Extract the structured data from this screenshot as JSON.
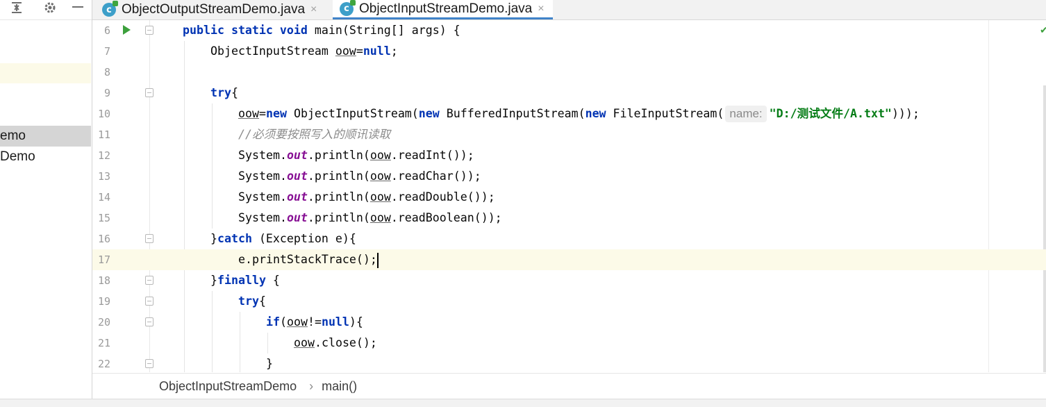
{
  "tabs": [
    {
      "label": "ObjectOutputStreamDemo.java",
      "icon": "java-class-icon",
      "close": "×",
      "active": false
    },
    {
      "label": "ObjectInputStreamDemo.java",
      "icon": "java-class-icon",
      "close": "×",
      "active": true
    }
  ],
  "project_tree": {
    "items": [
      {
        "label": "emo",
        "selected": true
      },
      {
        "label": "Demo",
        "selected": false
      }
    ]
  },
  "editor": {
    "current_line": 17,
    "lines": [
      {
        "no": "6"
      },
      {
        "no": "7"
      },
      {
        "no": "8"
      },
      {
        "no": "9"
      },
      {
        "no": "10"
      },
      {
        "no": "11"
      },
      {
        "no": "12"
      },
      {
        "no": "13"
      },
      {
        "no": "14"
      },
      {
        "no": "15"
      },
      {
        "no": "16"
      },
      {
        "no": "17"
      },
      {
        "no": "18"
      },
      {
        "no": "19"
      },
      {
        "no": "20"
      },
      {
        "no": "21"
      },
      {
        "no": "22"
      }
    ],
    "tokens": {
      "l6_public": "public",
      "l6_static": "static",
      "l6_void": "void",
      "l6_rest": " main(String[] args) {",
      "l7_type": "ObjectInputStream ",
      "l7_var": "oow",
      "l7_eq": "=",
      "l7_null": "null",
      "l7_end": ";",
      "l9_try": "try",
      "l9_brace": "{",
      "l10_var": "oow",
      "l10_eq": "=",
      "l10_new1": "new",
      "l10_a": " ObjectInputStream(",
      "l10_new2": "new",
      "l10_b": " BufferedInputStream(",
      "l10_new3": "new",
      "l10_c": " FileInputStream(",
      "l10_hint": "name:",
      "l10_str": "\"D:/测试文件/A.txt\"",
      "l10_end": ")));",
      "l11_comment": "//必须要按照写入的顺讯读取",
      "l12_sys": "System.",
      "l12_out": "out",
      "l12_mid": ".println(",
      "l12_var": "oow",
      "l12_end": ".readInt());",
      "l13_sys": "System.",
      "l13_out": "out",
      "l13_mid": ".println(",
      "l13_var": "oow",
      "l13_end": ".readChar());",
      "l14_sys": "System.",
      "l14_out": "out",
      "l14_mid": ".println(",
      "l14_var": "oow",
      "l14_end": ".readDouble());",
      "l15_sys": "System.",
      "l15_out": "out",
      "l15_mid": ".println(",
      "l15_var": "oow",
      "l15_end": ".readBoolean());",
      "l16_brace": "}",
      "l16_catch": "catch",
      "l16_rest": " (Exception e){",
      "l17_code": "e.printStackTrace();",
      "l18_brace": "}",
      "l18_finally": "finally",
      "l18_rest": " {",
      "l19_try": "try",
      "l19_brace": "{",
      "l20_if": "if",
      "l20_open": "(",
      "l20_var": "oow",
      "l20_ne": "!=",
      "l20_null": "null",
      "l20_end": "){",
      "l21_var": "oow",
      "l21_end": ".close();",
      "l22_brace": "}"
    }
  },
  "breadcrumb": {
    "items": [
      "ObjectInputStreamDemo",
      "main()"
    ],
    "separator": "›"
  },
  "colors": {
    "keyword": "#0033b3",
    "string": "#067d17",
    "static_field": "#871094",
    "comment": "#8c8c8c",
    "current_line": "#fcfae8",
    "active_tab_underline": "#4083c9"
  }
}
